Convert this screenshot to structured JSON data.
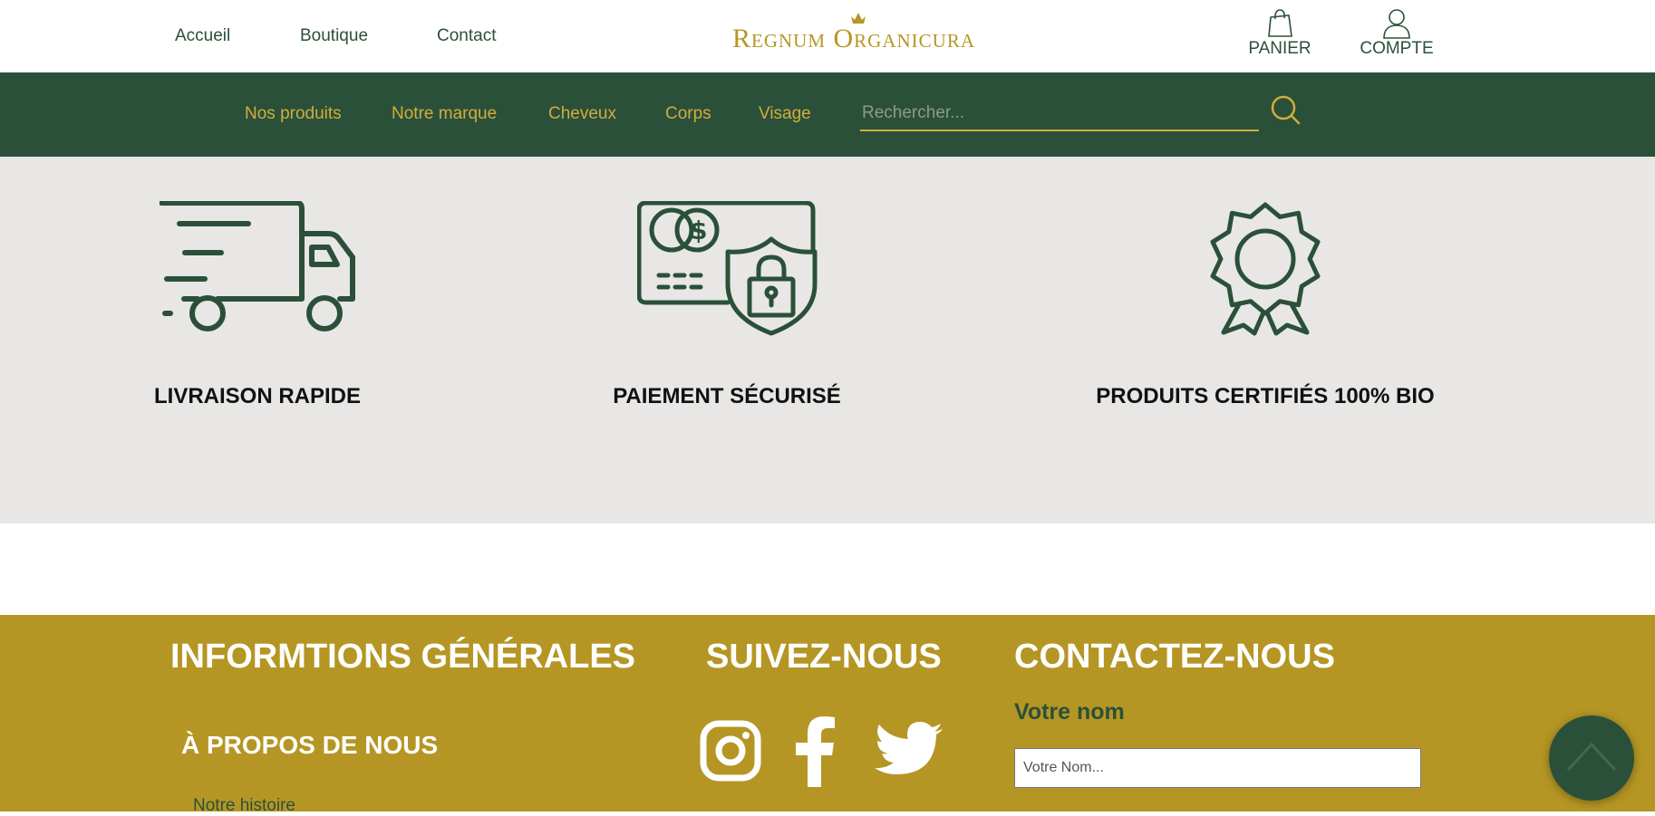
{
  "header": {
    "nav": [
      {
        "label": "Accueil"
      },
      {
        "label": "Boutique"
      },
      {
        "label": "Contact"
      }
    ],
    "brand": "Regnum Organicura",
    "cart_label": "PANIER",
    "account_label": "COMPTE"
  },
  "category_nav": {
    "items": [
      {
        "label": "Nos produits"
      },
      {
        "label": "Notre marque"
      },
      {
        "label": "Cheveux"
      },
      {
        "label": "Corps"
      },
      {
        "label": "Visage"
      }
    ],
    "search_placeholder": "Rechercher...",
    "search_value": ""
  },
  "features": [
    {
      "icon": "delivery-truck-icon",
      "title": "LIVRAISON RAPIDE"
    },
    {
      "icon": "secure-payment-icon",
      "title": "PAIEMENT SÉCURISÉ"
    },
    {
      "icon": "award-badge-icon",
      "title": "PRODUITS CERTIFIÉS 100% BIO"
    }
  ],
  "footer": {
    "info_heading": "INFORMTIONS GÉNÉRALES",
    "about_heading": "À PROPOS DE NOUS",
    "about_links": [
      {
        "label": "Notre histoire"
      }
    ],
    "follow_heading": "SUIVEZ-NOUS",
    "socials": [
      "instagram-icon",
      "facebook-icon",
      "twitter-icon"
    ],
    "contact_heading": "CONTACTEZ-NOUS",
    "name_label": "Votre nom",
    "name_placeholder": "Votre Nom...",
    "name_value": ""
  },
  "colors": {
    "brand_green": "#2b5039",
    "brand_gold": "#b59624",
    "nav_gold": "#d0ad3d",
    "feature_bg": "#e8e7e5"
  }
}
